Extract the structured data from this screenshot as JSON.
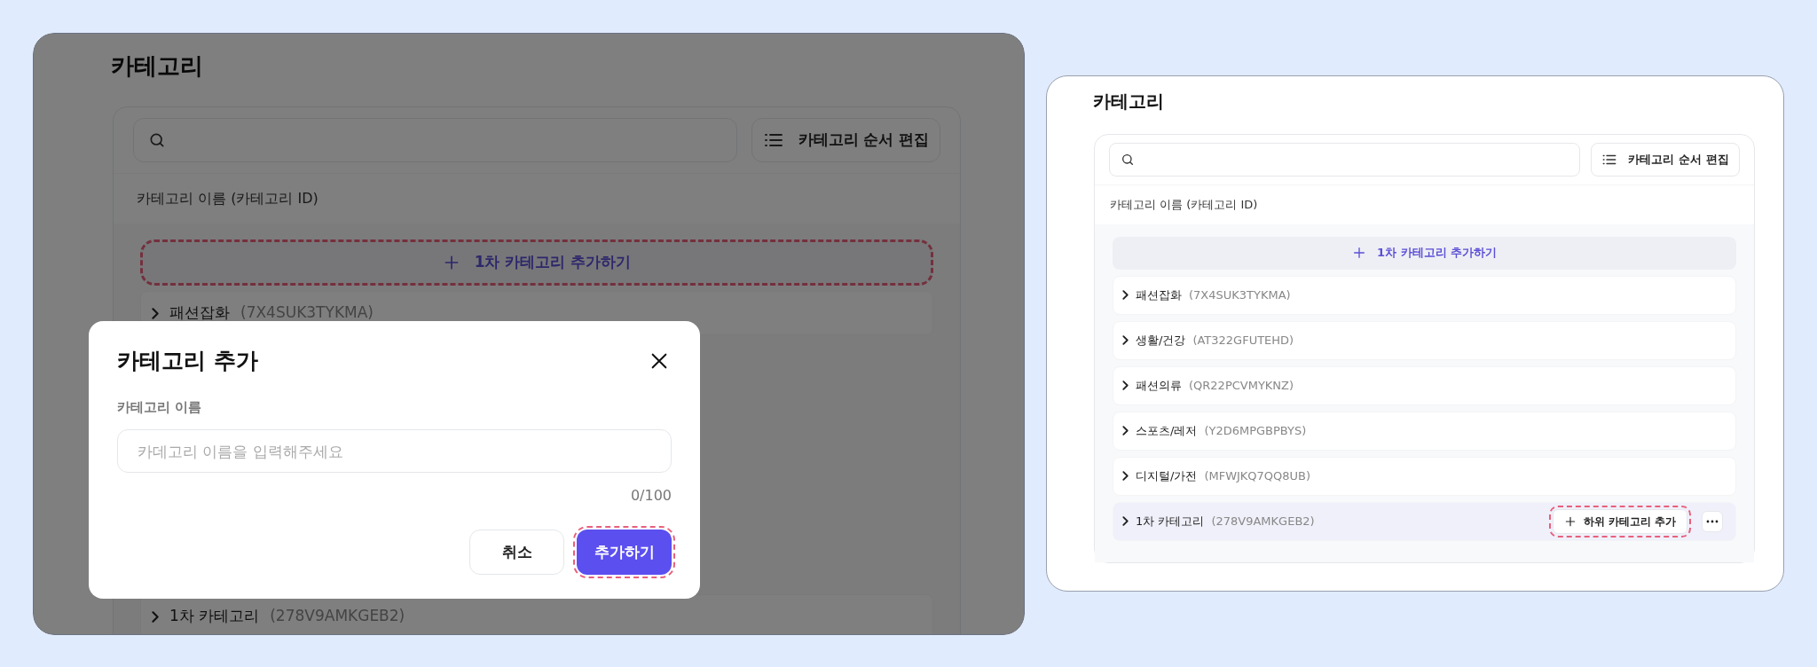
{
  "left_screen": {
    "dimmed": true,
    "title": "카테고리",
    "reorder_button": {
      "label": "카테고리 순서 편집"
    },
    "column_header": "카테고리 이름 (카테고리 ID)",
    "add_button": {
      "label": "1차 카테고리 추가하기",
      "highlighted": true
    },
    "rows": [
      {
        "name": "패션잡화",
        "id": "(7X4SUK3TYKMA)"
      },
      {
        "name": "1차 카테고리",
        "id": "(278V9AMKGEB2)"
      }
    ],
    "modal": {
      "title": "카테고리 추가",
      "field_label": "카테고리 이름",
      "placeholder": "카데고리 이름을 입력해주세요",
      "counter": "0/100",
      "cancel": {
        "label": "취소",
        "highlighted": false
      },
      "confirm": {
        "label": "추가하기",
        "highlighted": true
      }
    }
  },
  "right_screen": {
    "title": "카테고리",
    "reorder_button": {
      "label": "카테고리 순서 편집"
    },
    "column_header": "카테고리 이름 (카테고리 ID)",
    "add_button": {
      "label": "1차 카테고리 추가하기",
      "highlighted": false
    },
    "rows": [
      {
        "name": "패션잡화",
        "id": "(7X4SUK3TYKMA)",
        "selected": false
      },
      {
        "name": "생활/건강",
        "id": "(AT322GFUTEHD)",
        "selected": false
      },
      {
        "name": "패션의류",
        "id": "(QR22PCVMYKNZ)",
        "selected": false
      },
      {
        "name": "스포츠/레저",
        "id": "(Y2D6MPGBPBYS)",
        "selected": false
      },
      {
        "name": "디지털/가전",
        "id": "(MFWJKQ7QQ8UB)",
        "selected": false
      },
      {
        "name": "1차 카테고리",
        "id": "(278V9AMKGEB2)",
        "selected": true,
        "sub_add_button": {
          "label": "하위 카테고리 추가",
          "highlighted": true
        }
      }
    ]
  }
}
